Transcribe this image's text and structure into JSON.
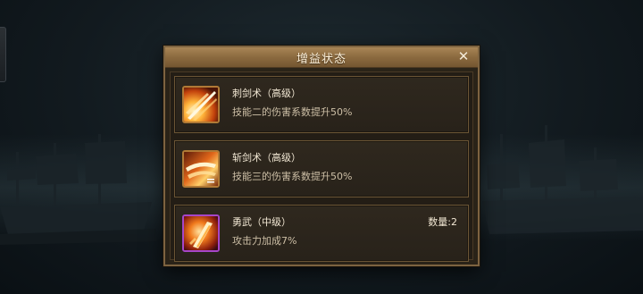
{
  "dialog": {
    "title": "增益状态",
    "close_icon": "close-icon"
  },
  "buffs": [
    {
      "name": "刺剑术（高级）",
      "description": "技能二的伤害系数提升50%",
      "icon": "sword-thrust-icon",
      "frame_color": "#b07a36"
    },
    {
      "name": "斩剑术（高级）",
      "description": "技能三的伤害系数提升50%",
      "icon": "sword-slash-icon",
      "frame_color": "#b07a36"
    },
    {
      "name": "勇武（中级）",
      "description": "攻击力加成7%",
      "icon": "valor-blade-icon",
      "frame_color": "#a646c8",
      "quantity_label": "数量:2"
    }
  ],
  "colors": {
    "title_bar": "#8b6a3f",
    "panel_border": "#7d6340",
    "text_primary": "#f1e7d3",
    "text_secondary": "#cdbfa6"
  }
}
